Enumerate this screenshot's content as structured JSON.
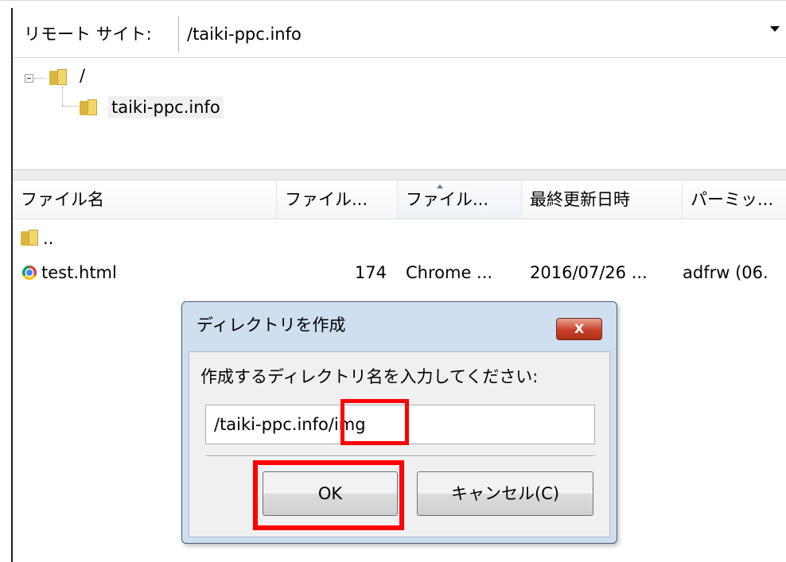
{
  "remote_site": {
    "label": "リモート サイト:",
    "path": "/taiki-ppc.info"
  },
  "tree": {
    "root_label": "/",
    "child_label": "taiki-ppc.info"
  },
  "file_list": {
    "columns": [
      "ファイル名",
      "ファイル...",
      "ファイル...",
      "最終更新日時",
      "パーミッ..."
    ],
    "rows": [
      {
        "name": "..",
        "size": "",
        "type": "",
        "modified": "",
        "permissions": "",
        "icon": "folder-icon"
      },
      {
        "name": "test.html",
        "size": "174",
        "type": "Chrome ...",
        "modified": "2016/07/26 ...",
        "permissions": "adfrw (06.",
        "icon": "chrome-icon"
      }
    ]
  },
  "dialog": {
    "title": "ディレクトリを作成",
    "close_label": "X",
    "prompt": "作成するディレクトリ名を入力してください:",
    "input_value": "/taiki-ppc.info/img",
    "ok_label": "OK",
    "cancel_label": "キャンセル(C)"
  },
  "colors": {
    "highlight": "#ff0000",
    "dialog_frame": "#cfdff0",
    "close_button": "#c7402a",
    "folder": "#f2d669"
  }
}
